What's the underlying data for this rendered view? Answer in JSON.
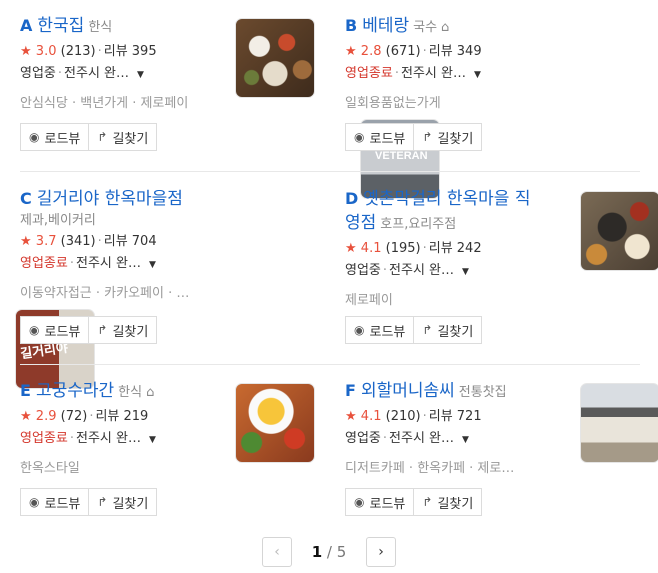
{
  "places": [
    {
      "letter": "A",
      "name": "한국집",
      "category": "한식",
      "home": false,
      "sub": "",
      "score": "3.0",
      "reviews_count": "(213)",
      "review_label": "리뷰 395",
      "status": "영업중",
      "status_closed": false,
      "address": "전주시 완…",
      "tags": "안심식당 · 백년가게 · 제로페이",
      "img_text": ""
    },
    {
      "letter": "B",
      "name": "베테랑",
      "category": "국수",
      "home": true,
      "sub": "",
      "score": "2.8",
      "reviews_count": "(671)",
      "review_label": "리뷰 349",
      "status": "영업종료",
      "status_closed": true,
      "address": "전주시 완…",
      "tags": "일회용품없는가게",
      "img_text": "VETERAN"
    },
    {
      "letter": "C",
      "name": "길거리야 한옥마을점",
      "category": "",
      "home": false,
      "sub": "제과,베이커리",
      "score": "3.7",
      "reviews_count": "(341)",
      "review_label": "리뷰 704",
      "status": "영업종료",
      "status_closed": true,
      "address": "전주시 완…",
      "tags": "이동약자접근 · 카카오페이 · …",
      "img_text": "길거리야"
    },
    {
      "letter": "D",
      "name": "옛촌막걸리 한옥마을 직영점",
      "category": "호프,요리주점",
      "home": false,
      "sub": "",
      "score": "4.1",
      "reviews_count": "(195)",
      "review_label": "리뷰 242",
      "status": "영업중",
      "status_closed": false,
      "address": "전주시 완…",
      "tags": "제로페이",
      "img_text": ""
    },
    {
      "letter": "E",
      "name": "고궁수라간",
      "category": "한식",
      "home": true,
      "sub": "",
      "score": "2.9",
      "reviews_count": "(72)",
      "review_label": "리뷰 219",
      "status": "영업종료",
      "status_closed": true,
      "address": "전주시 완…",
      "tags": "한옥스타일",
      "img_text": ""
    },
    {
      "letter": "F",
      "name": "외할머니솜씨",
      "category": "전통찻집",
      "home": false,
      "sub": "",
      "score": "4.1",
      "reviews_count": "(210)",
      "review_label": "리뷰 721",
      "status": "영업중",
      "status_closed": false,
      "address": "전주시 완…",
      "tags": "디저트카페 · 한옥카페 · 제로…",
      "img_text": ""
    }
  ],
  "buttons": {
    "roadview": "로드뷰",
    "directions": "길찾기"
  },
  "pagination": {
    "current": "1",
    "separator": "/",
    "total": "5"
  },
  "colors": {
    "link": "#1a66c8",
    "star": "#e8513c",
    "closed": "#d4372c"
  }
}
